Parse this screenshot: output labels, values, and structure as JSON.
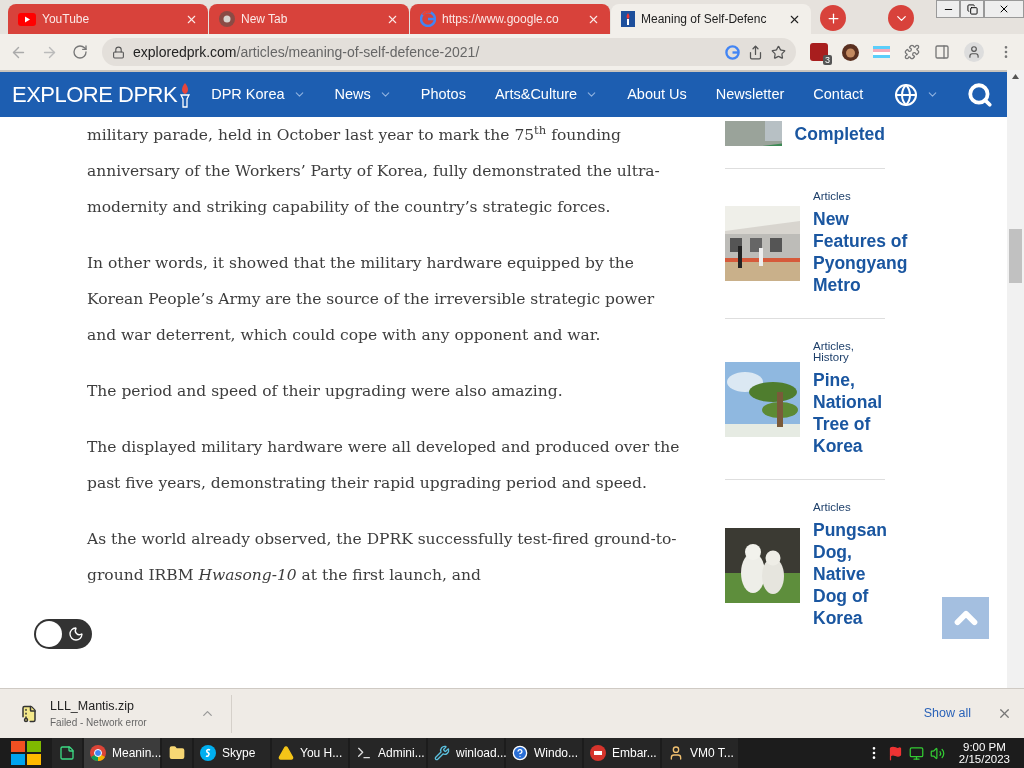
{
  "tabs": [
    {
      "title": "YouTube",
      "kind": "youtube",
      "selected": false
    },
    {
      "title": "New Tab",
      "kind": "chrome",
      "selected": false
    },
    {
      "title": "https://www.google.co",
      "kind": "google",
      "selected": false
    },
    {
      "title": "Meaning of Self-Defenc",
      "kind": "site",
      "selected": true
    }
  ],
  "address_bar": {
    "url_host": "exploredprk.com",
    "url_path": "/articles/meaning-of-self-defence-2021/",
    "extension_badge": "3"
  },
  "site_nav": {
    "logo": "EXPLORE DPRK",
    "items": [
      {
        "label": "DPR Korea",
        "has_menu": true
      },
      {
        "label": "News",
        "has_menu": true
      },
      {
        "label": "Photos",
        "has_menu": false
      },
      {
        "label": "Arts&Culture",
        "has_menu": true
      },
      {
        "label": "About Us",
        "has_menu": false
      },
      {
        "label": "Newsletter",
        "has_menu": false
      },
      {
        "label": "Contact",
        "has_menu": false
      }
    ]
  },
  "article": {
    "paragraphs": [
      "military parade, held in October last year to mark the 75$^{th}$ founding anniversary of the Workers’ Party of Korea, fully demonstrated the ultra-modernity and striking capability of the country’s strategic forces.",
      "In other words, it showed that the military hardware equipped by the Korean People’s Army are the source of the irreversible strategic power and war deterrent, which could cope with any opponent and war.",
      "The period and speed of their upgrading were also amazing.",
      "The displayed military hardware were all developed and produced over the past five years, demonstrating their rapid upgrading period and speed.",
      "As the world already observed, the DPRK successfully test-fired ground-to-ground IRBM *Hwasong-10* at the first launch, and"
    ]
  },
  "sidebar": {
    "items": [
      {
        "title": "Completed",
        "kind": "road"
      },
      {
        "category": "Articles",
        "title": "New Features of Pyongyang Metro",
        "kind": "metro"
      },
      {
        "category": "Articles, History",
        "title": "Pine, National Tree of Korea",
        "kind": "tree"
      },
      {
        "category": "Articles",
        "title": "Pungsan Dog, Native Dog of Korea",
        "kind": "dogs"
      }
    ]
  },
  "dark_mode_toggle": {
    "on": false
  },
  "download_bar": {
    "file": "LLL_Mantis.zip",
    "status": "Failed - Network error",
    "show_all": "Show all"
  },
  "taskbar": {
    "apps": [
      {
        "kind": "notes",
        "selected": false
      },
      {
        "label": "Meanin...",
        "kind": "chrome",
        "selected": true
      },
      {
        "kind": "folder",
        "selected": false
      },
      {
        "label": "Skype",
        "kind": "skype",
        "selected": false
      },
      {
        "label": "You H...",
        "kind": "warning",
        "selected": false
      },
      {
        "label": "Admini...",
        "kind": "cmd",
        "selected": false
      },
      {
        "label": "winload...",
        "kind": "tool",
        "selected": false
      },
      {
        "label": "Windo...",
        "kind": "help",
        "selected": false
      },
      {
        "label": "Embar...",
        "kind": "dev",
        "selected": false
      },
      {
        "label": "VM0 T...",
        "kind": "person",
        "selected": false
      }
    ],
    "time": "9:00 PM",
    "date": "2/15/2023"
  }
}
